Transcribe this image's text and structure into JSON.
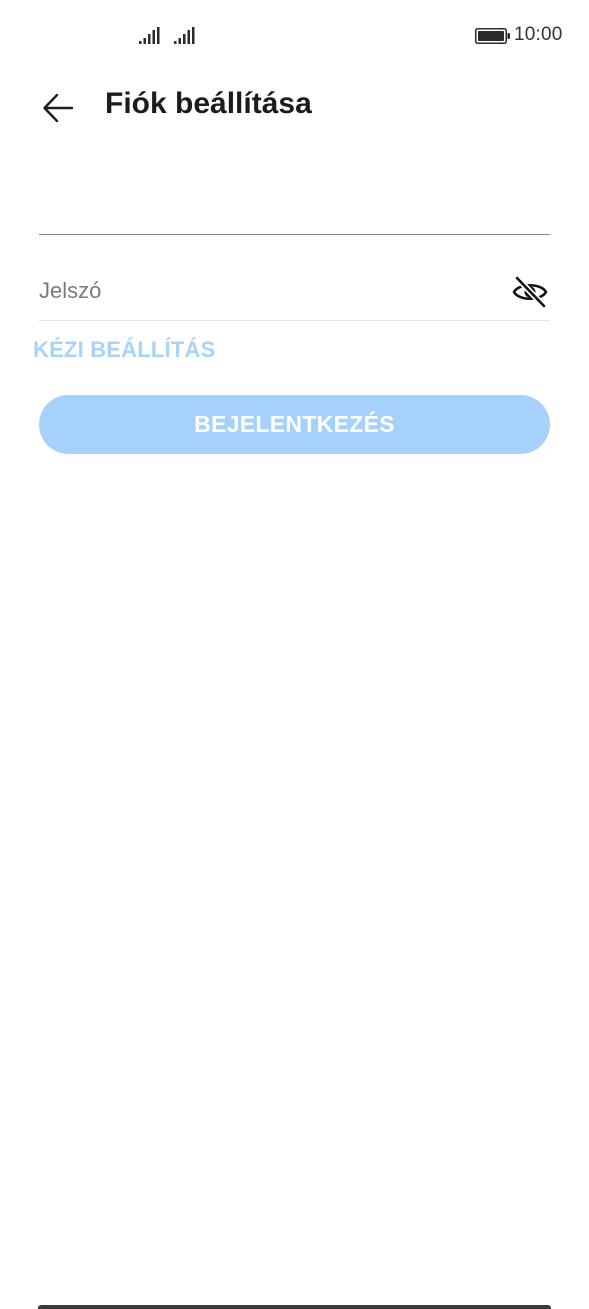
{
  "status_bar": {
    "time": "10:00",
    "signal_icons": [
      "signal-icon",
      "signal-icon"
    ],
    "battery_icon": "battery-full-icon"
  },
  "header": {
    "back_icon": "arrow-left-icon",
    "title": "Fiók beállítása"
  },
  "form": {
    "email_value": "",
    "password_placeholder": "Jelszó",
    "password_toggle_icon": "eye-off-icon",
    "manual_setup_label": "KÉZI BEÁLLÍTÁS",
    "login_label": "BEJELENTKEZÉS"
  },
  "colors": {
    "accent_light": "#a5d1fb",
    "link_color": "#a9d3fa",
    "text_primary": "#1c1c1c"
  }
}
